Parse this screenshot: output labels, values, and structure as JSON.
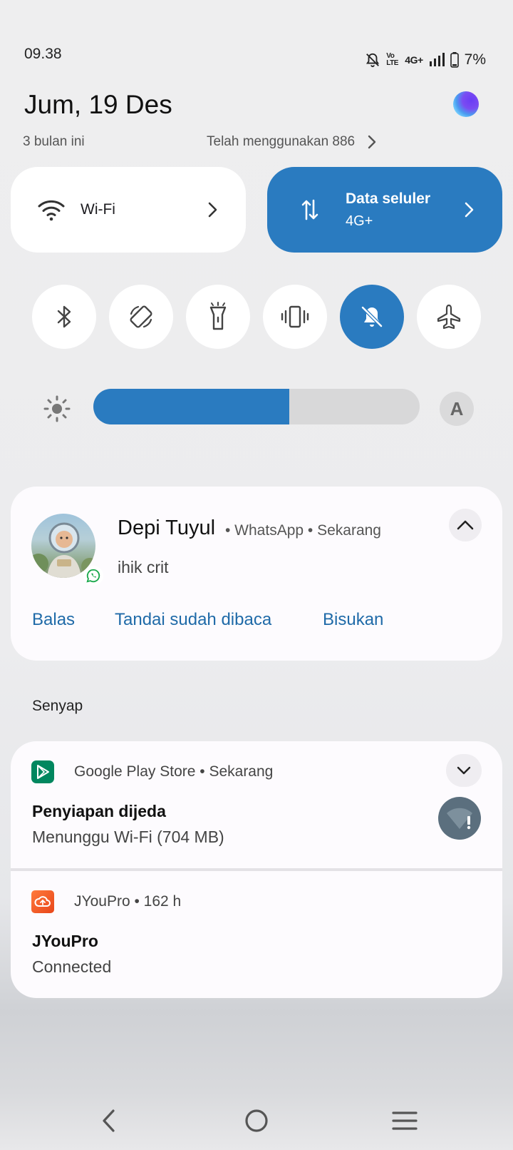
{
  "status_bar": {
    "time": "09.38",
    "network_type": "4G+",
    "volte_label": "Vo LTE",
    "battery_percent": "7%"
  },
  "header": {
    "date": "Jum, 19 Des",
    "usage_left": "3 bulan ini",
    "usage_right": "Telah menggunakan 886"
  },
  "quick_tiles": {
    "wifi": {
      "label": "Wi-Fi"
    },
    "mobile_data": {
      "label": "Data seluler",
      "sub": "4G+",
      "color": "#2a7bc0"
    }
  },
  "toggles": [
    {
      "name": "bluetooth",
      "icon": "bluetooth-icon",
      "on": false
    },
    {
      "name": "auto-rotate",
      "icon": "rotate-icon",
      "on": false
    },
    {
      "name": "flashlight",
      "icon": "flashlight-icon",
      "on": false
    },
    {
      "name": "vibrate",
      "icon": "vibrate-icon",
      "on": false
    },
    {
      "name": "mute",
      "icon": "bell-off-icon",
      "on": true
    },
    {
      "name": "airplane",
      "icon": "airplane-icon",
      "on": false
    }
  ],
  "brightness": {
    "level_percent": 60,
    "auto_label": "A"
  },
  "whatsapp_notification": {
    "sender": "Depi Tuyul",
    "app_meta": "• WhatsApp • Sekarang",
    "message": "ihik crit",
    "actions": [
      "Balas",
      "Tandai sudah dibaca",
      "Bisukan"
    ]
  },
  "silent_section": {
    "label": "Senyap",
    "play_store": {
      "meta": "Google Play Store • Sekarang",
      "title": "Penyiapan dijeda",
      "subtitle": "Menunggu Wi-Fi (704 MB)"
    },
    "jyoupro": {
      "meta": "JYouPro • 162 h",
      "title": "JYouPro",
      "subtitle": "Connected"
    }
  },
  "nav_bar": [
    "back",
    "home",
    "recents"
  ]
}
